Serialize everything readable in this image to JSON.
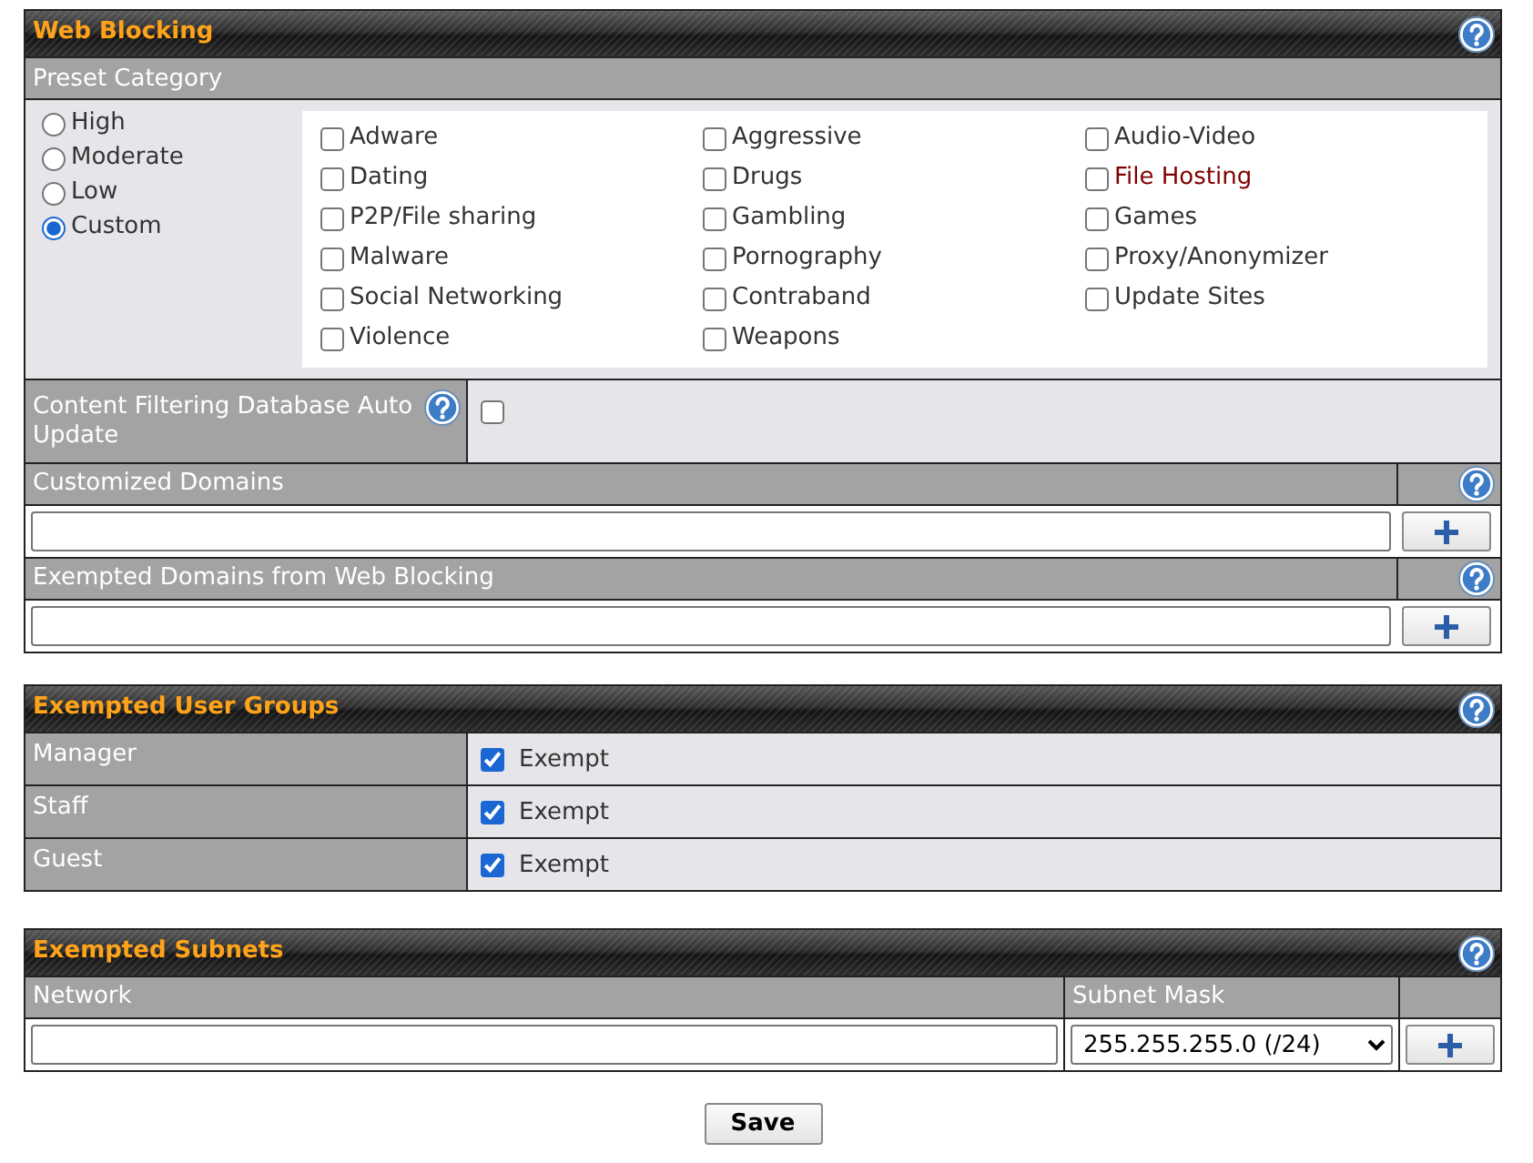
{
  "web_blocking": {
    "title": "Web Blocking",
    "preset_category": {
      "label": "Preset Category",
      "presets": [
        {
          "label": "High",
          "selected": false
        },
        {
          "label": "Moderate",
          "selected": false
        },
        {
          "label": "Low",
          "selected": false
        },
        {
          "label": "Custom",
          "selected": true
        }
      ],
      "categories": [
        {
          "label": "Adware",
          "checked": false,
          "color": "#333333"
        },
        {
          "label": "Aggressive",
          "checked": false,
          "color": "#333333"
        },
        {
          "label": "Audio-Video",
          "checked": false,
          "color": "#333333"
        },
        {
          "label": "Dating",
          "checked": false,
          "color": "#333333"
        },
        {
          "label": "Drugs",
          "checked": false,
          "color": "#333333"
        },
        {
          "label": "File Hosting",
          "checked": false,
          "color": "#800000"
        },
        {
          "label": "P2P/File sharing",
          "checked": false,
          "color": "#333333"
        },
        {
          "label": "Gambling",
          "checked": false,
          "color": "#333333"
        },
        {
          "label": "Games",
          "checked": false,
          "color": "#333333"
        },
        {
          "label": "Malware",
          "checked": false,
          "color": "#333333"
        },
        {
          "label": "Pornography",
          "checked": false,
          "color": "#333333"
        },
        {
          "label": "Proxy/Anonymizer",
          "checked": false,
          "color": "#333333"
        },
        {
          "label": "Social Networking",
          "checked": false,
          "color": "#333333"
        },
        {
          "label": "Contraband",
          "checked": false,
          "color": "#333333"
        },
        {
          "label": "Update Sites",
          "checked": false,
          "color": "#333333"
        },
        {
          "label": "Violence",
          "checked": false,
          "color": "#333333"
        },
        {
          "label": "Weapons",
          "checked": false,
          "color": "#333333"
        }
      ]
    },
    "auto_update": {
      "label": "Content Filtering Database Auto Update",
      "checked": false
    },
    "domain_lists": [
      {
        "label": "Customized Domains"
      },
      {
        "label": "Exempted Domains from Web Blocking"
      }
    ]
  },
  "exempted_user_groups": {
    "title": "Exempted User Groups",
    "groups": [
      {
        "name": "Manager",
        "option": "Exempt",
        "checked": true
      },
      {
        "name": "Staff",
        "option": "Exempt",
        "checked": true
      },
      {
        "name": "Guest",
        "option": "Exempt",
        "checked": true
      }
    ]
  },
  "exempted_subnets": {
    "title": "Exempted Subnets",
    "columns": [
      "Network",
      "Subnet Mask"
    ],
    "subnet_mask": "255.255.255.0 (/24)"
  },
  "save_button": "Save"
}
